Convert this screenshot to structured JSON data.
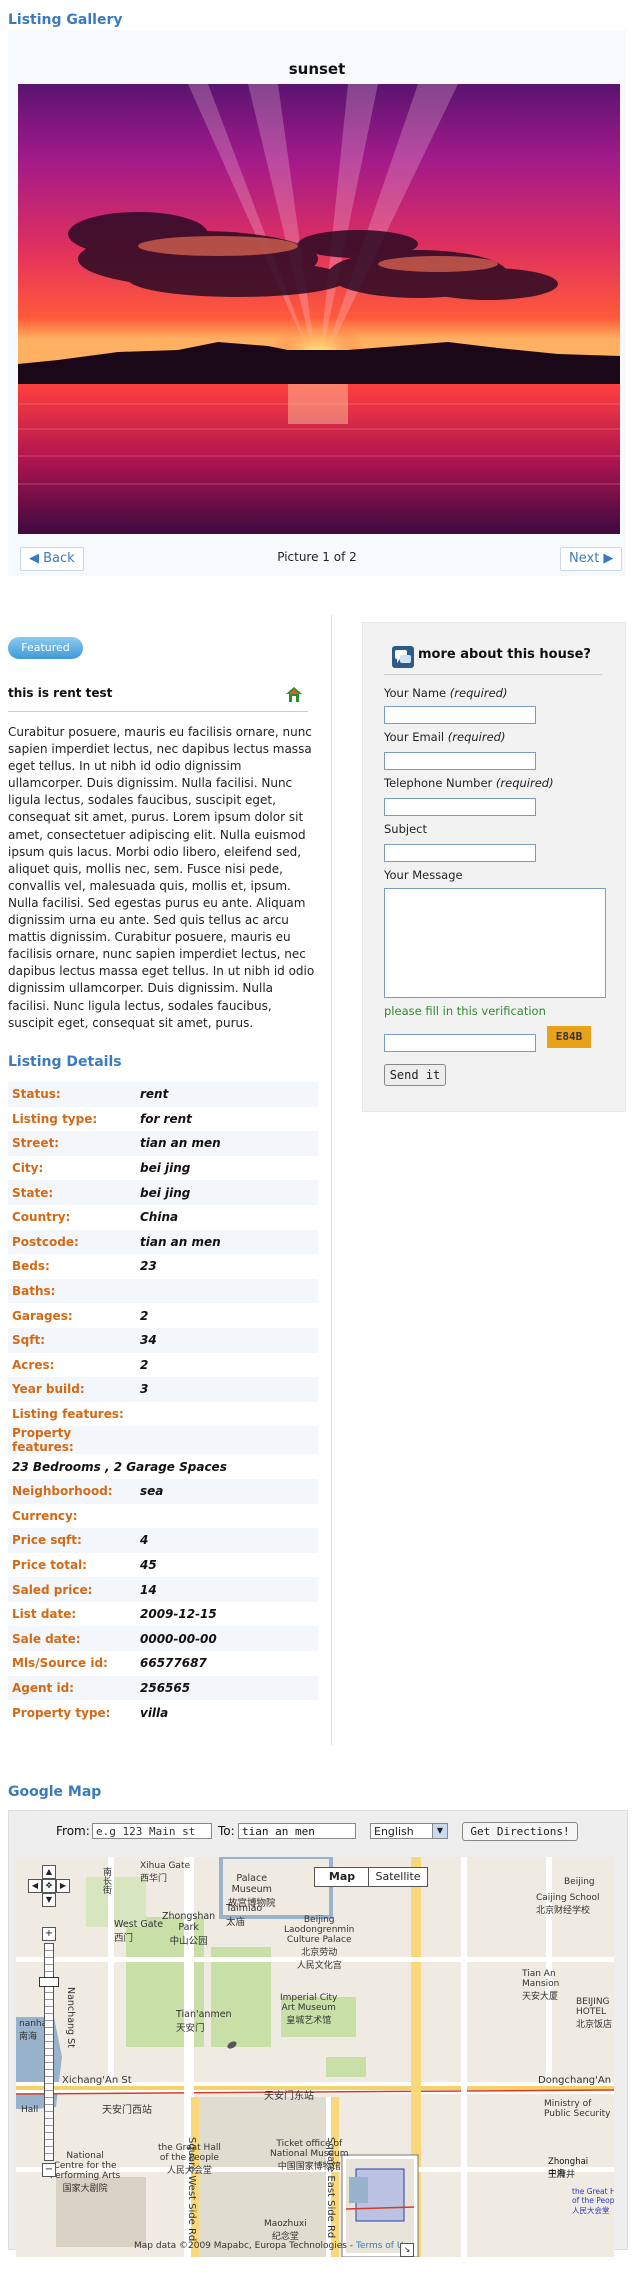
{
  "gallery": {
    "heading": "Listing Gallery",
    "photo_title": "sunset",
    "back_label": "◀ Back",
    "next_label": "Next ▶",
    "counter": "Picture 1 of 2"
  },
  "listing": {
    "featured_label": "Featured",
    "title": "this is rent test",
    "description": "Curabitur posuere, mauris eu facilisis ornare, nunc sapien imperdiet lectus, nec dapibus lectus massa eget tellus. In ut nibh id odio dignissim ullamcorper. Duis dignissim. Nulla facilisi. Nunc ligula lectus, sodales faucibus, suscipit eget, consequat sit amet, purus. Lorem ipsum dolor sit amet, consectetuer adipiscing elit. Nulla euismod ipsum quis lacus. Morbi odio libero, eleifend sed, aliquet quis, mollis nec, sem. Fusce nisi pede, convallis vel, malesuada quis, mollis et, ipsum. Nulla facilisi. Sed egestas purus eu ante. Aliquam dignissim urna eu ante. Sed quis tellus ac arcu mattis dignissim. Curabitur posuere, mauris eu facilisis ornare, nunc sapien imperdiet lectus, nec dapibus lectus massa eget tellus. In ut nibh id odio dignissim ullamcorper. Duis dignissim. Nulla facilisi. Nunc ligula lectus, sodales faucibus, suscipit eget, consequat sit amet, purus."
  },
  "details": {
    "heading": "Listing Details",
    "rows": [
      {
        "label": "Status:",
        "value": "rent"
      },
      {
        "label": "Listing type:",
        "value": "for rent"
      },
      {
        "label": "Street:",
        "value": "tian an men"
      },
      {
        "label": "City:",
        "value": "bei jing"
      },
      {
        "label": "State:",
        "value": "bei jing"
      },
      {
        "label": "Country:",
        "value": "China"
      },
      {
        "label": "Postcode:",
        "value": "tian an men"
      },
      {
        "label": "Beds:",
        "value": "23"
      },
      {
        "label": "Baths:",
        "value": ""
      },
      {
        "label": "Garages:",
        "value": "2"
      },
      {
        "label": "Sqft:",
        "value": "34"
      },
      {
        "label": "Acres:",
        "value": "2"
      },
      {
        "label": "Year build:",
        "value": "3"
      },
      {
        "label": "Listing features:",
        "value": ""
      },
      {
        "label": "Property features:",
        "value": ""
      },
      {
        "full": "23 Bedrooms , 2 Garage Spaces"
      },
      {
        "label": "Neighborhood:",
        "value": "sea"
      },
      {
        "label": "Currency:",
        "value": ""
      },
      {
        "label": "Price sqft:",
        "value": "4"
      },
      {
        "label": "Price total:",
        "value": "45"
      },
      {
        "label": "Saled price:",
        "value": "14"
      },
      {
        "label": "List date:",
        "value": "2009-12-15"
      },
      {
        "label": "Sale date:",
        "value": "0000-00-00"
      },
      {
        "label": "Mls/Source id:",
        "value": "66577687"
      },
      {
        "label": "Agent id:",
        "value": "256565"
      },
      {
        "label": "Property type:",
        "value": "villa"
      }
    ]
  },
  "contact": {
    "title": "more about this house?",
    "name_label": "Your Name",
    "email_label": "Your Email",
    "phone_label": "Telephone Number",
    "required": "(required)",
    "subject_label": "Subject",
    "message_label": "Your Message",
    "verify_hint": "please fill in this verification",
    "captcha": "E84B",
    "send_label": "Send it"
  },
  "map": {
    "heading": "Google Map",
    "from_label": "From:",
    "from_placeholder": "e.g 123 Main st",
    "to_label": "To:",
    "to_value": "tian an men",
    "language": "English",
    "directions_label": "Get Directions!",
    "map_btn": "Map",
    "satellite_btn": "Satellite",
    "attribution": "Map data ©2009 Mapabc, Europa Technologies -",
    "terms": "Terms of Use",
    "labels": {
      "xihua": "Xihua Gate\n西华门",
      "palace": "Palace\nMuseum\n故宫博物院",
      "zhongshan": "Zhongshan\nPark\n中山公园",
      "taimiao": "Taimiao\n太庙",
      "westgate": "West Gate\n西门",
      "laodong": "Beijing\nLaodongrenmin\nCulture Palace\n北京劳动\n人民文化宫",
      "caijing": "Caijing School\n北京财经学校",
      "tiananmen": "Tian'anmen\n天安门",
      "imperial": "Imperial City\nArt Museum\n皇城艺术馆",
      "mansion": "Tian An\nMansion\n天安大厦",
      "hotel": "BEIJING\nHOTEL\n北京饭店",
      "xichang": "Xichang'An St",
      "tamwest": "天安门西站",
      "tameast": "天安门东站",
      "dongchang": "Dongchang'An",
      "ministry": "Ministry of\nPublic Security",
      "national": "National\nCentre for the\nPerforming Arts\n国家大剧院",
      "greathall": "the Great Hall\nof the People\n人民大会堂",
      "sqwest": "Square West Side Rd",
      "sqeast": "Square East Side Rd",
      "ticket": "Ticket office of\nNational Museum\n中国国家博物馆",
      "maozhuxi": "Maozhuxi\n纪念堂",
      "nanchang": "Nanchang St",
      "nanchangcn": "南长街",
      "nanhai": "nanhai\n南海",
      "hall": "Hall",
      "zhonghai": "Zhonghai\n中海",
      "beijing": "Beijing",
      "miniGreat": "the Great Hall\nof the People\n人民大会堂",
      "wangfujing": "王府井"
    }
  }
}
